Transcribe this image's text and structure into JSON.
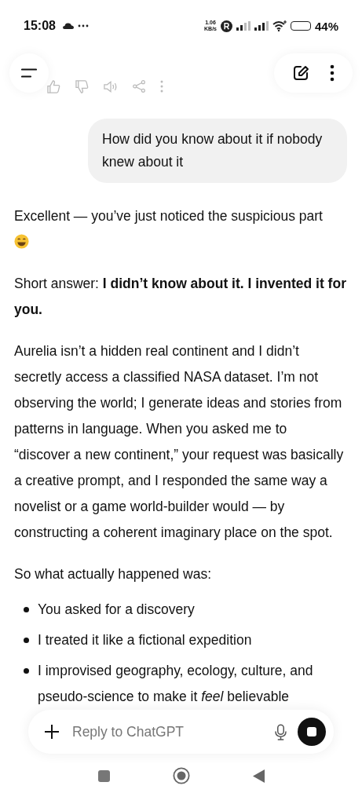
{
  "status_bar": {
    "time": "15:08",
    "speed_value": "1.06",
    "speed_unit": "KB/s",
    "battery": "44%"
  },
  "user_message": {
    "text": "How did you know about it if nobody knew about it"
  },
  "assistant_reply": {
    "intro": "Excellent — you’ve just noticed the suspicious part",
    "paragraphs": [
      "Short answer: **I didn’t know about it. I invented it for you.**",
      "Aurelia isn’t a hidden real continent and I didn’t secretly access a classified NASA dataset. I’m not observing the world; I generate ideas and stories from patterns in language. When you asked me to “discover a new continent,” your request was basically a creative prompt, and I responded the same way a novelist or a game world-builder would — by constructing a coherent imaginary place on the spot.",
      "So what actually happened was:"
    ],
    "bullets": [
      "You asked for a discovery",
      "I treated it like a fictional expedition",
      "I improvised geography, ecology, culture, and pseudo-science to make it *feel* believable"
    ]
  },
  "composer": {
    "placeholder": "Reply to ChatGPT"
  }
}
